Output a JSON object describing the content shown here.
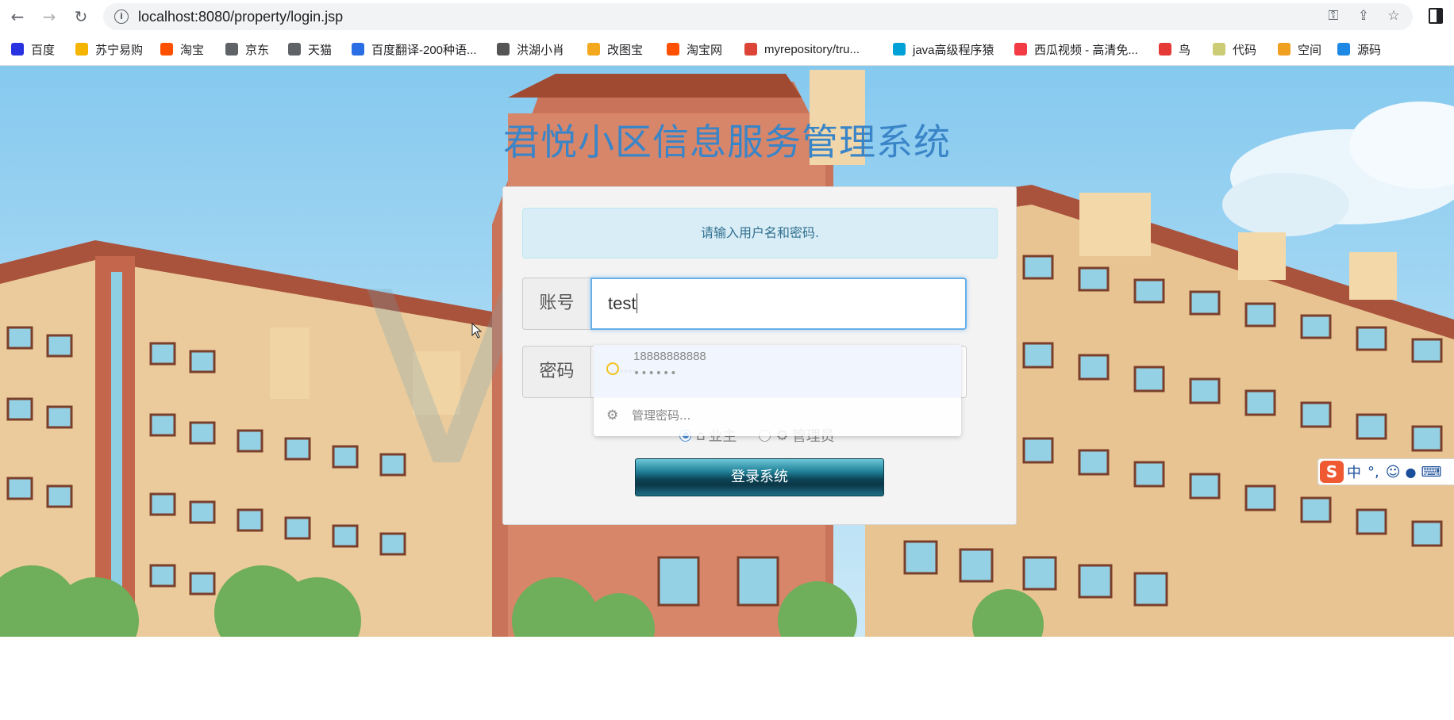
{
  "browser": {
    "url": "localhost:8080/property/login.jsp",
    "nav": {
      "back": "←",
      "forward": "→",
      "reload": "↻"
    }
  },
  "bookmarks": [
    {
      "label": "百度",
      "icon": "baidu-paw-icon",
      "color": "#2932e1"
    },
    {
      "label": "苏宁易购",
      "icon": "suning-icon",
      "color": "#f5b400"
    },
    {
      "label": "淘宝",
      "icon": "taobao-icon",
      "color": "#ff5000"
    },
    {
      "label": "京东",
      "icon": "globe-icon",
      "color": "#5f6368"
    },
    {
      "label": "天猫",
      "icon": "globe-icon",
      "color": "#5f6368"
    },
    {
      "label": "百度翻译-200种语...",
      "icon": "translate-icon",
      "color": "#2b6de5"
    },
    {
      "label": "洪湖小肖",
      "icon": "bird-icon",
      "color": "#555555"
    },
    {
      "label": "改图宝",
      "icon": "square-icon",
      "color": "#f4a81d"
    },
    {
      "label": "淘宝网",
      "icon": "taobao-icon",
      "color": "#ff5000"
    },
    {
      "label": "myrepository/tru...",
      "icon": "chrome-icon",
      "color": "#db4437"
    },
    {
      "label": "java高级程序猿",
      "icon": "bilibili-icon",
      "color": "#00a1d6"
    },
    {
      "label": "西瓜视频 - 高清免...",
      "icon": "play-icon",
      "color": "#f33b45"
    },
    {
      "label": "鸟",
      "icon": "bird-icon",
      "color": "#e53935"
    },
    {
      "label": "代码",
      "icon": "leaf-icon",
      "color": "#cccc77"
    },
    {
      "label": "空间",
      "icon": "qzone-icon",
      "color": "#f0a020"
    },
    {
      "label": "源码",
      "icon": "fish-icon",
      "color": "#1e88e5"
    }
  ],
  "page": {
    "title": "君悦小区信息服务管理系统",
    "alert": "请输入用户名和密码.",
    "username_label": "账号",
    "username_value": "test",
    "password_label": "密码",
    "password_dots": "••••••",
    "roles": [
      {
        "label": "业主",
        "icon": "home-icon",
        "selected": true
      },
      {
        "label": "管理员",
        "icon": "gear-icon",
        "selected": false
      }
    ],
    "submit": "登录系统"
  },
  "autocomplete": {
    "username": "18888888888",
    "password": "••••••",
    "manage": "管理密码..."
  },
  "ime": {
    "logo": "S",
    "mode": "中",
    "punct": "°,",
    "emoji": "☺",
    "mic": "🎤",
    "keyboard": "⌨"
  },
  "colors": {
    "title": "#3a85c8",
    "alert_bg": "#d9edf7",
    "alert_text": "#31708f",
    "button": "#0c4457",
    "focus": "#66afe9"
  }
}
